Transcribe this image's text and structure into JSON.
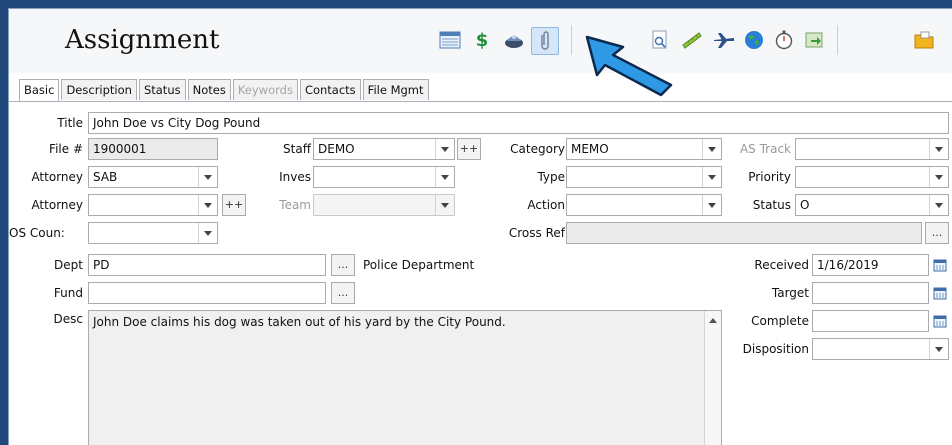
{
  "header": {
    "title": "Assignment"
  },
  "toolbar": {
    "icons": [
      "list-view-icon",
      "dollar-icon",
      "cap-icon",
      "paperclip-icon",
      "document-search-icon",
      "ruler-icon",
      "airplane-icon",
      "globe-icon",
      "stopwatch-icon",
      "export-icon",
      "folder-icon"
    ],
    "active_icon": "paperclip-icon",
    "accent": "#2e9ae6"
  },
  "tabs": [
    {
      "label": "Basic",
      "state": "active"
    },
    {
      "label": "Description",
      "state": "normal"
    },
    {
      "label": "Status",
      "state": "normal"
    },
    {
      "label": "Notes",
      "state": "normal"
    },
    {
      "label": "Keywords",
      "state": "disabled"
    },
    {
      "label": "Contacts",
      "state": "normal"
    },
    {
      "label": "File Mgmt",
      "state": "normal"
    }
  ],
  "form": {
    "title_label": "Title",
    "title_value": "John Doe vs City Dog Pound",
    "file_label": "File #",
    "file_value": "1900001",
    "staff_label": "Staff",
    "staff_value": "DEMO",
    "plus_label": "++",
    "category_label": "Category",
    "category_value": "MEMO",
    "as_track_label": "AS Track",
    "as_track_value": "",
    "attorney1_label": "Attorney",
    "attorney1_value": "SAB",
    "inves_label": "Inves",
    "inves_value": "",
    "type_label": "Type",
    "type_value": "",
    "priority_label": "Priority",
    "priority_value": "",
    "attorney2_label": "Attorney",
    "attorney2_value": "",
    "team_label": "Team",
    "team_value": "",
    "action_label": "Action",
    "action_value": "",
    "status_label": "Status",
    "status_value": "O",
    "os_counsel_label": "OS Coun:",
    "os_counsel_value": "",
    "cross_ref_label": "Cross Ref",
    "cross_ref_value": "",
    "ellipsis_label": "...",
    "dept_label": "Dept",
    "dept_value": "PD",
    "dept_name": "Police Department",
    "received_label": "Received",
    "received_value": "1/16/2019",
    "fund_label": "Fund",
    "fund_value": "",
    "target_label": "Target",
    "target_value": "",
    "desc_label": "Desc",
    "desc_value": "John Doe claims his dog was taken out of his yard by the City Pound.",
    "complete_label": "Complete",
    "complete_value": "",
    "disposition_label": "Disposition",
    "disposition_value": ""
  }
}
